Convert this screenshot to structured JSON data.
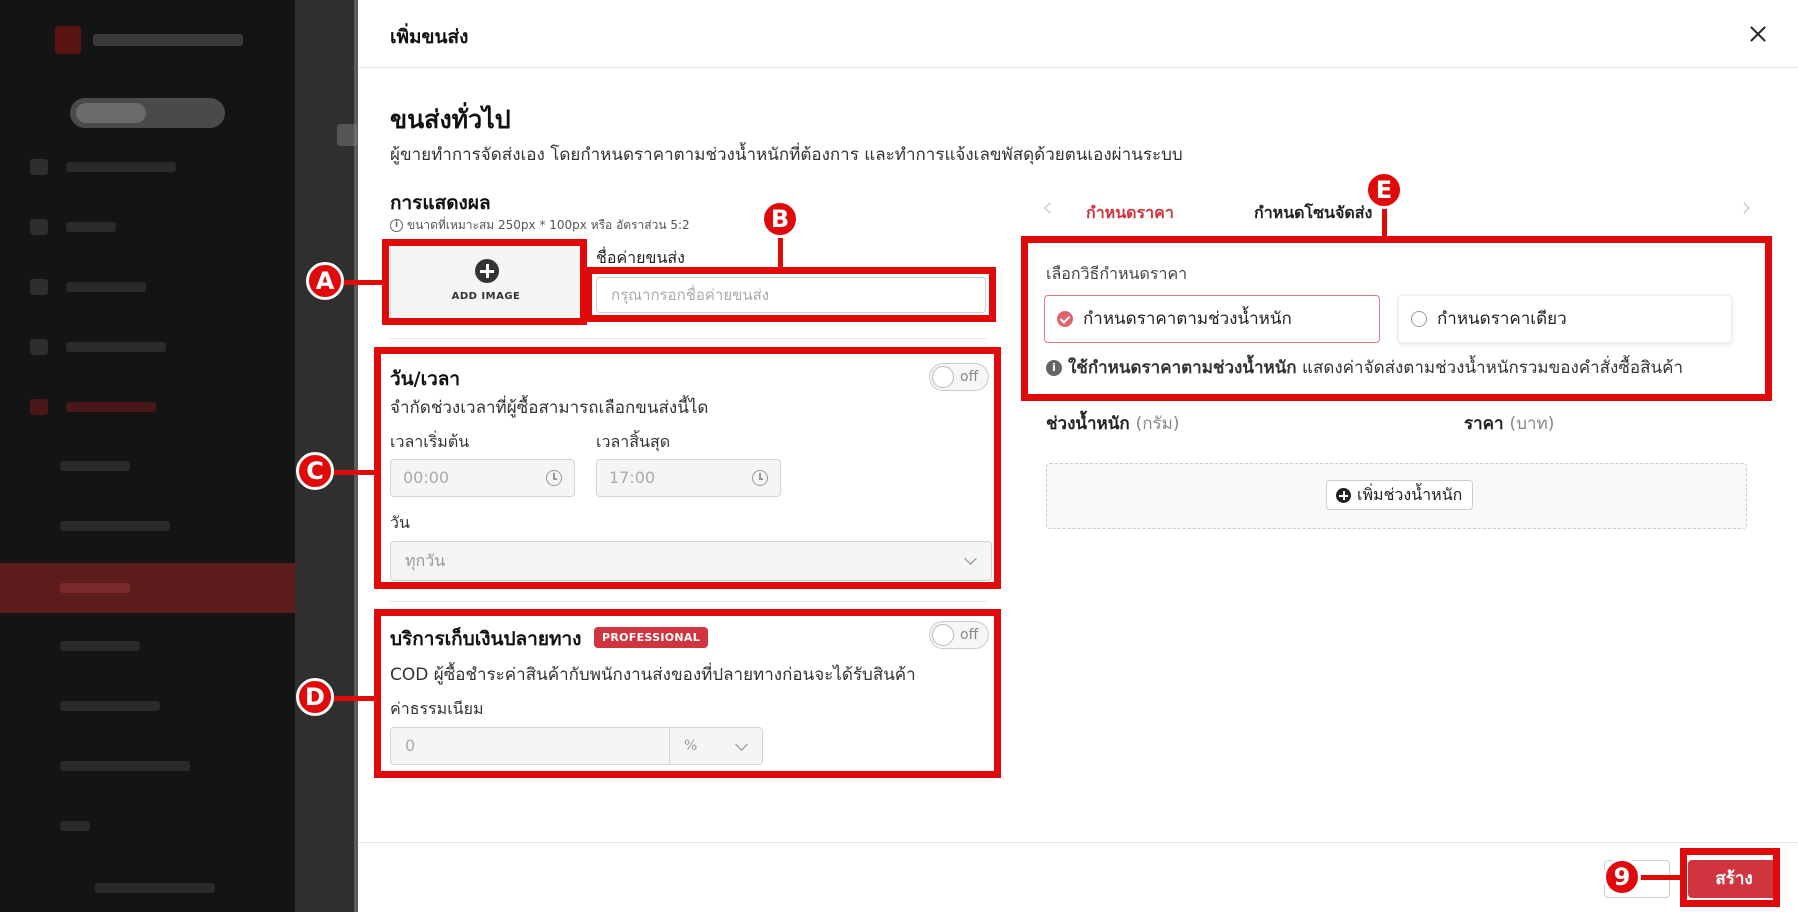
{
  "drawer": {
    "title": "เพิ่มขนส่ง",
    "section_title": "ขนส่งทั่วไป",
    "section_desc": "ผู้ขายทำการจัดส่งเอง โดยกำหนดราคาตามช่วงน้ำหนักที่ต้องการ และทำการแจ้งเลขพัสดุด้วยตนเองผ่านระบบ"
  },
  "display": {
    "label": "การแสดงผล",
    "hint": "ขนาดที่เหมาะสม 250px * 100px หรือ อัตราส่วน 5:2",
    "add_image": "ADD IMAGE",
    "carrier_label": "ชื่อค่ายขนส่ง",
    "carrier_placeholder": "กรุณากรอกชื่อค่ายขนส่ง"
  },
  "datetime": {
    "title": "วัน/เวลา",
    "toggle": "off",
    "desc": "จำกัดช่วงเวลาที่ผู้ซื้อสามารถเลือกขนส่งนี้ได",
    "start_label": "เวลาเริ่มต้น",
    "start_value": "00:00",
    "end_label": "เวลาสิ้นสุด",
    "end_value": "17:00",
    "day_label": "วัน",
    "day_value": "ทุกวัน"
  },
  "cod": {
    "title": "บริการเก็บเงินปลายทาง",
    "badge": "PROFESSIONAL",
    "toggle": "off",
    "desc": "COD ผู้ซื้อชำระค่าสินค้ากับพนักงานส่งของที่ปลายทางก่อนจะได้รับสินค้า",
    "fee_label": "ค่าธรรมเนียม",
    "fee_value": "0",
    "fee_unit": "%"
  },
  "pricing": {
    "tab_active": "กำหนดราคา",
    "tab_zone": "กำหนดโซนจัดส่ง",
    "method_label": "เลือกวิธีกำหนดราคา",
    "option_weight": "กำหนดราคาตามช่วงน้ำหนัก",
    "option_flat": "กำหนดราคาเดียว",
    "note_bold": "ใช้กำหนดราคาตามช่วงน้ำหนัก",
    "note_rest": " แสดงค่าจัดส่งตามช่วงน้ำหนักรวมของคำสั่งซื้อสินค้า",
    "col_weight": "ช่วงน้ำหนัก",
    "col_weight_unit": "(กรัม)",
    "col_price": "ราคา",
    "col_price_unit": "(บาท)",
    "add_range": "เพิ่มช่วงน้ำหนัก"
  },
  "footer": {
    "create": "สร้าง"
  },
  "annotations": {
    "a": "A",
    "b": "B",
    "c": "C",
    "d": "D",
    "e": "E",
    "nine": "9"
  },
  "colors": {
    "accent": "#d0353f",
    "annotation": "#e00a0a"
  }
}
